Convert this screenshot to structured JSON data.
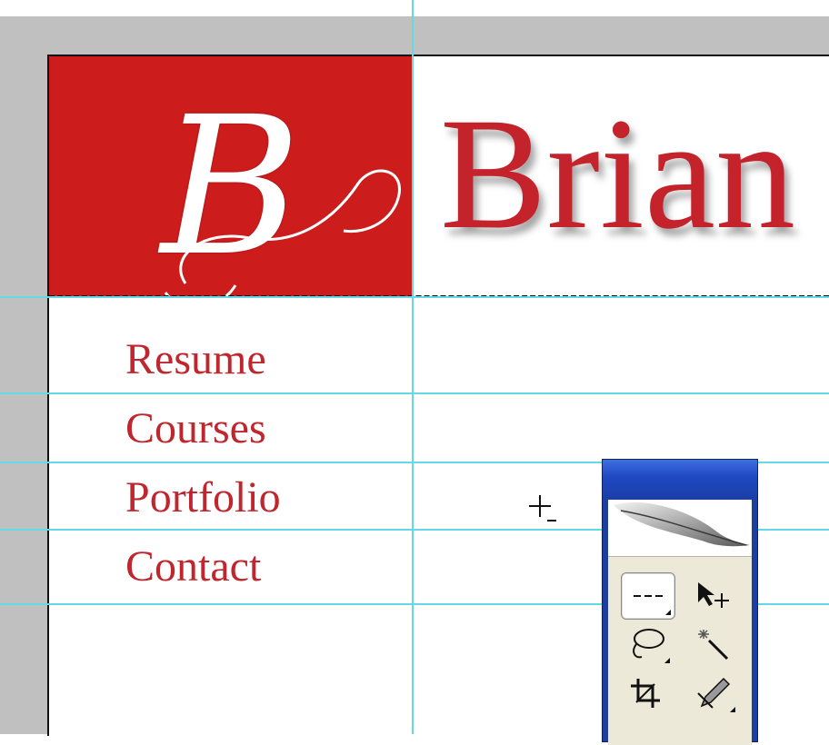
{
  "document": {
    "logo_letter": "B",
    "name_visible": "Brian",
    "background_color": "#cc1c1c",
    "accent_color": "#c4232b",
    "guide_color": "#63d9e6"
  },
  "nav": {
    "items": [
      {
        "label": "Resume"
      },
      {
        "label": "Courses"
      },
      {
        "label": "Portfolio"
      },
      {
        "label": "Contact"
      }
    ]
  },
  "tools_palette": {
    "tools": [
      {
        "name": "rectangular-marquee-tool",
        "selected": true
      },
      {
        "name": "move-tool",
        "selected": false
      },
      {
        "name": "lasso-tool",
        "selected": false
      },
      {
        "name": "magic-wand-tool",
        "selected": false
      },
      {
        "name": "crop-tool",
        "selected": false
      },
      {
        "name": "slice-tool",
        "selected": false
      }
    ]
  }
}
